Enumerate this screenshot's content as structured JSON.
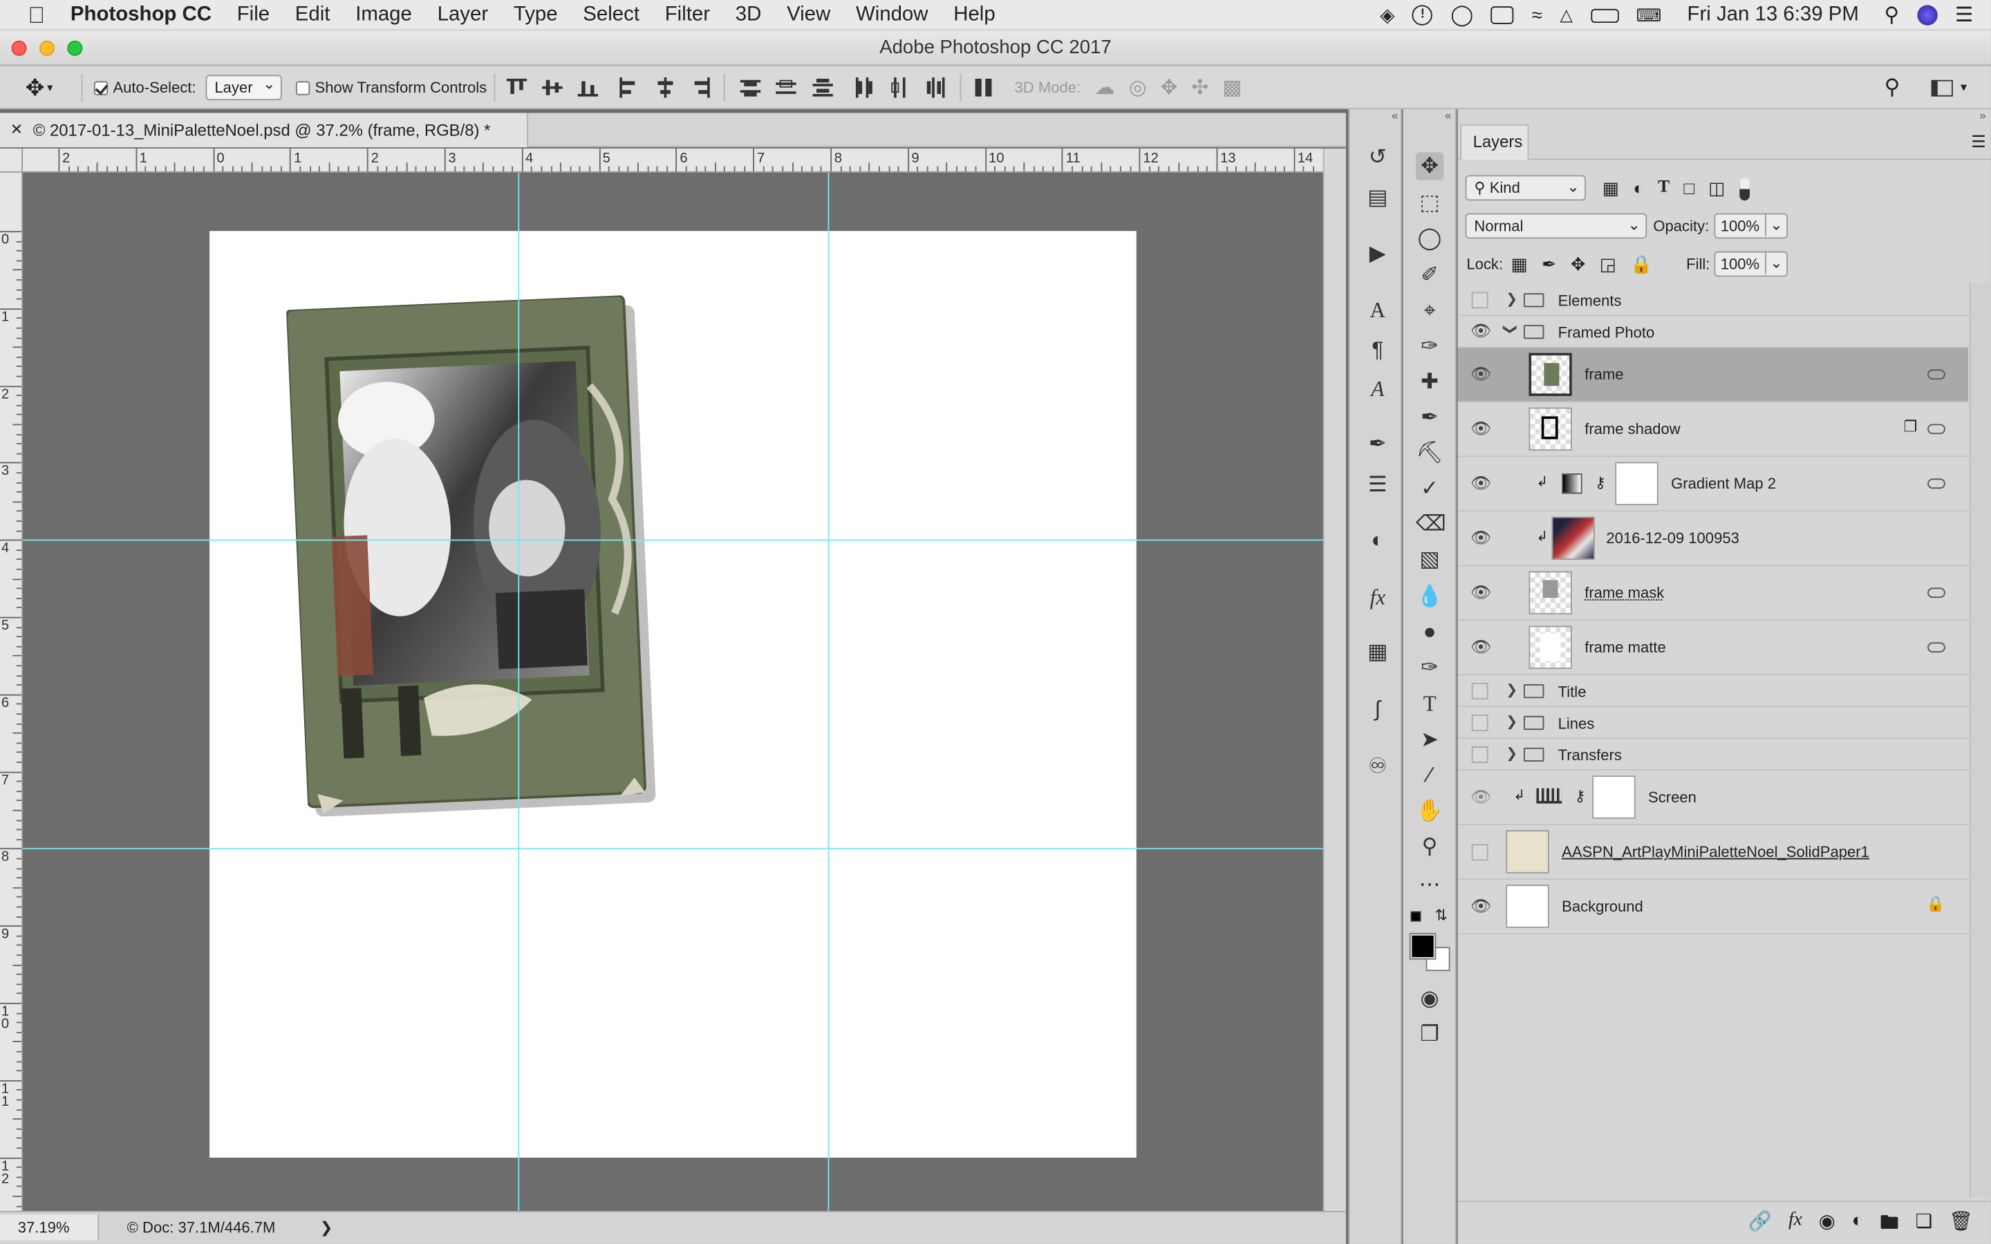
{
  "menubar": {
    "app": "Photoshop CC",
    "items": [
      "File",
      "Edit",
      "Image",
      "Layer",
      "Type",
      "Select",
      "Filter",
      "3D",
      "View",
      "Window",
      "Help"
    ],
    "clock": "Fri Jan 13  6:39 PM"
  },
  "window": {
    "title": "Adobe Photoshop CC 2017"
  },
  "options": {
    "auto_select_label": "Auto-Select:",
    "auto_select_value": "Layer",
    "transform_label": "Show Transform Controls",
    "mode3d_label": "3D Mode:"
  },
  "document": {
    "tab_title": "© 2017-01-13_MiniPaletteNoel.psd @ 37.2% (frame, RGB/8) *",
    "zoom": "37.19%",
    "doc_info": "© Doc: 37.1M/446.7M"
  },
  "rulers": {
    "horizontal": [
      "2",
      "1",
      "0",
      "1",
      "2",
      "3",
      "4",
      "5",
      "6",
      "7",
      "8",
      "9",
      "10",
      "11",
      "12",
      "13",
      "14"
    ],
    "vertical": [
      "0",
      "1",
      "2",
      "3",
      "4",
      "5",
      "6",
      "7",
      "8",
      "9",
      "10",
      "11",
      "12"
    ]
  },
  "layers_panel": {
    "tab": "Layers",
    "filter_kind": "Kind",
    "blend_mode": "Normal",
    "opacity_label": "Opacity:",
    "opacity_value": "100%",
    "lock_label": "Lock:",
    "fill_label": "Fill:",
    "fill_value": "100%",
    "layers": [
      {
        "name": "Elements",
        "type": "group",
        "visible": false,
        "expanded": false
      },
      {
        "name": "Framed Photo",
        "type": "group",
        "visible": true,
        "expanded": true
      },
      {
        "name": "frame",
        "type": "layer",
        "visible": true,
        "selected": true
      },
      {
        "name": "frame shadow",
        "type": "layer",
        "visible": true
      },
      {
        "name": "Gradient Map 2",
        "type": "adjustment",
        "visible": true
      },
      {
        "name": "2016-12-09 100953",
        "type": "layer",
        "visible": true
      },
      {
        "name": "frame mask",
        "type": "layer",
        "visible": true
      },
      {
        "name": "frame matte",
        "type": "layer",
        "visible": true
      },
      {
        "name": "Title",
        "type": "group",
        "visible": false,
        "expanded": false
      },
      {
        "name": "Lines",
        "type": "group",
        "visible": false,
        "expanded": false
      },
      {
        "name": "Transfers",
        "type": "group",
        "visible": false,
        "expanded": false
      },
      {
        "name": "Screen",
        "type": "adjustment",
        "visible": true
      },
      {
        "name": "AASPN_ArtPlayMiniPaletteNoel_SolidPaper1",
        "type": "layer",
        "visible": false
      },
      {
        "name": "Background",
        "type": "layer",
        "visible": true,
        "locked": true
      }
    ]
  }
}
